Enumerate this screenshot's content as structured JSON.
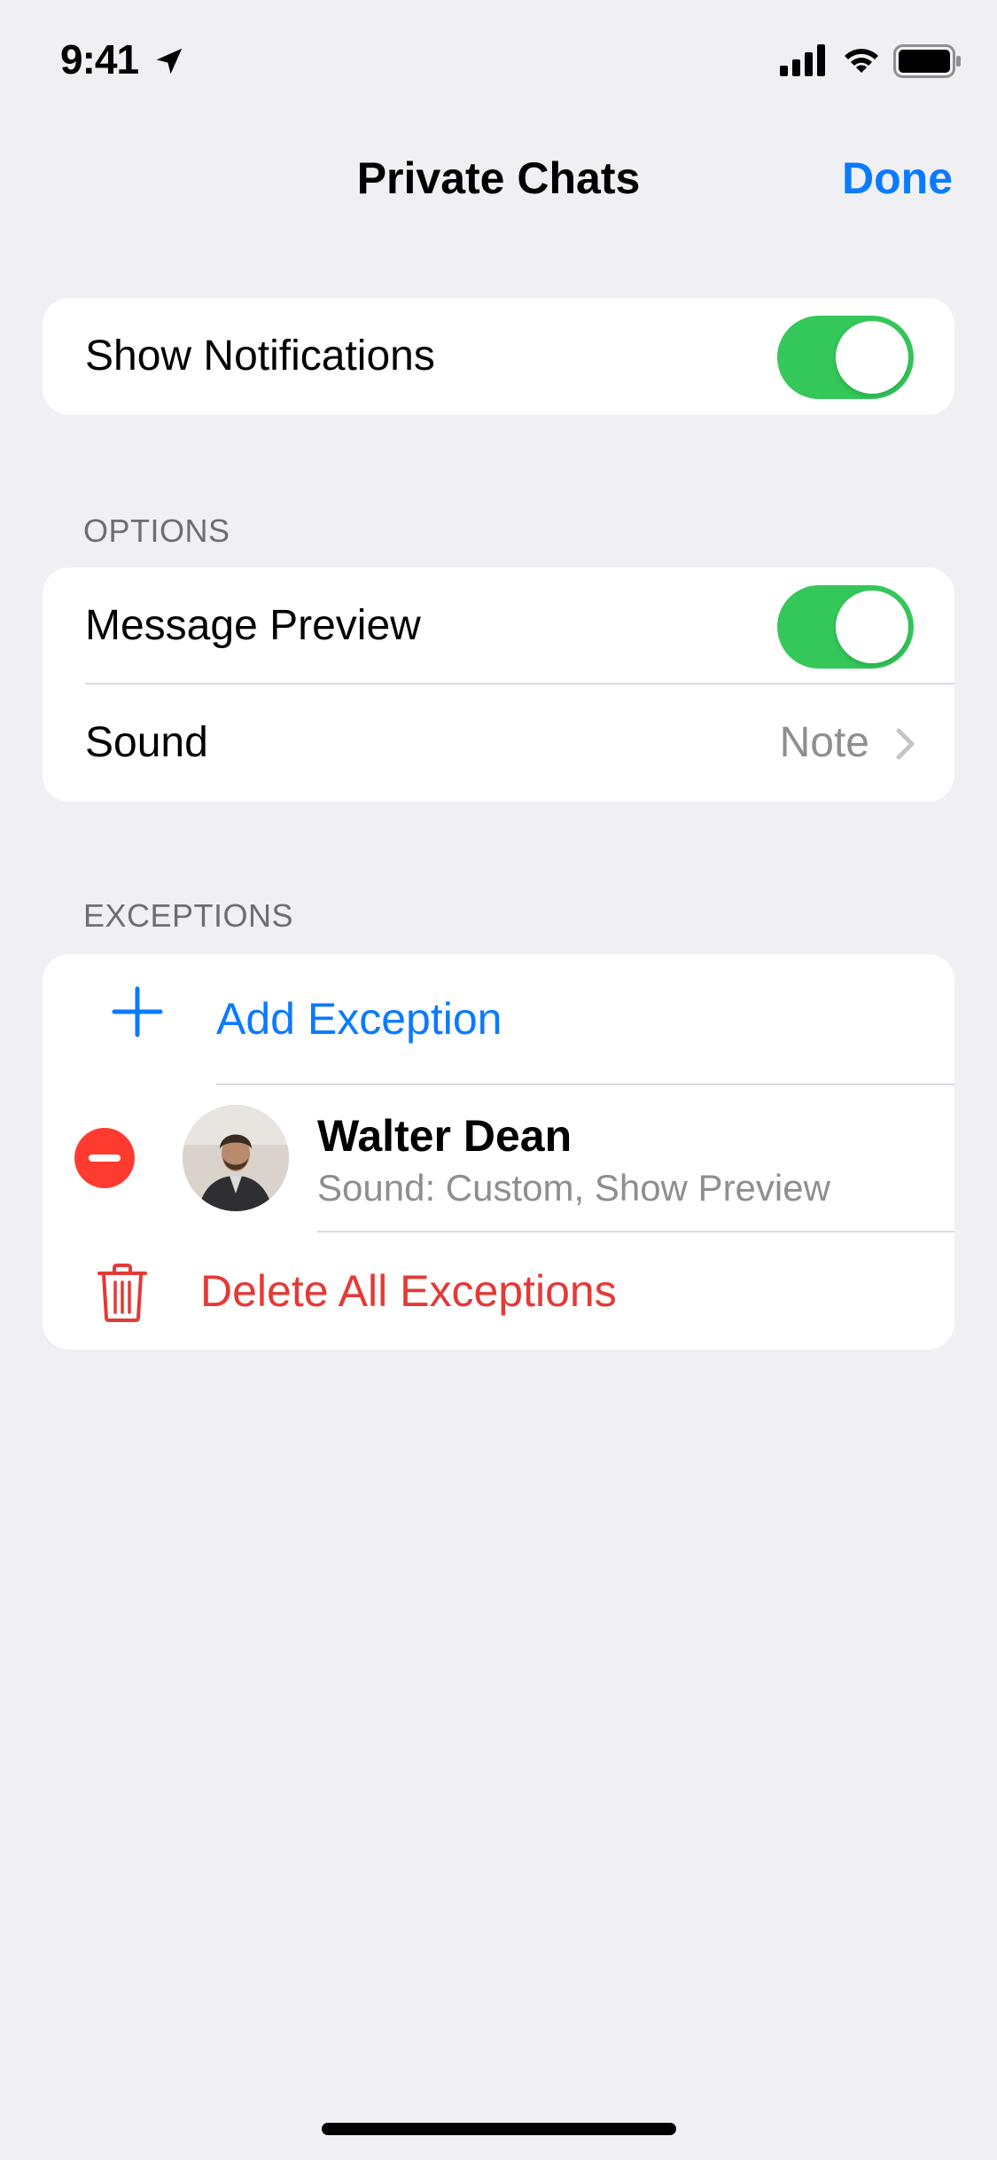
{
  "status_bar": {
    "time": "9:41",
    "location_icon": "location-arrow-icon",
    "signal_icon": "cellular-signal-icon",
    "wifi_icon": "wifi-icon",
    "battery_icon": "battery-icon"
  },
  "nav": {
    "title": "Private Chats",
    "done_label": "Done"
  },
  "notifications": {
    "show_label": "Show Notifications",
    "show_enabled": true
  },
  "options": {
    "header": "OPTIONS",
    "message_preview_label": "Message Preview",
    "message_preview_enabled": true,
    "sound_label": "Sound",
    "sound_value": "Note"
  },
  "exceptions": {
    "header": "EXCEPTIONS",
    "add_label": "Add Exception",
    "items": [
      {
        "name": "Walter Dean",
        "detail": "Sound: Custom, Show Preview"
      }
    ],
    "delete_all_label": "Delete All Exceptions"
  },
  "colors": {
    "accent": "#0a7aff",
    "toggle_on": "#34c759",
    "destructive": "#ff3b30",
    "background": "#efeff4"
  }
}
